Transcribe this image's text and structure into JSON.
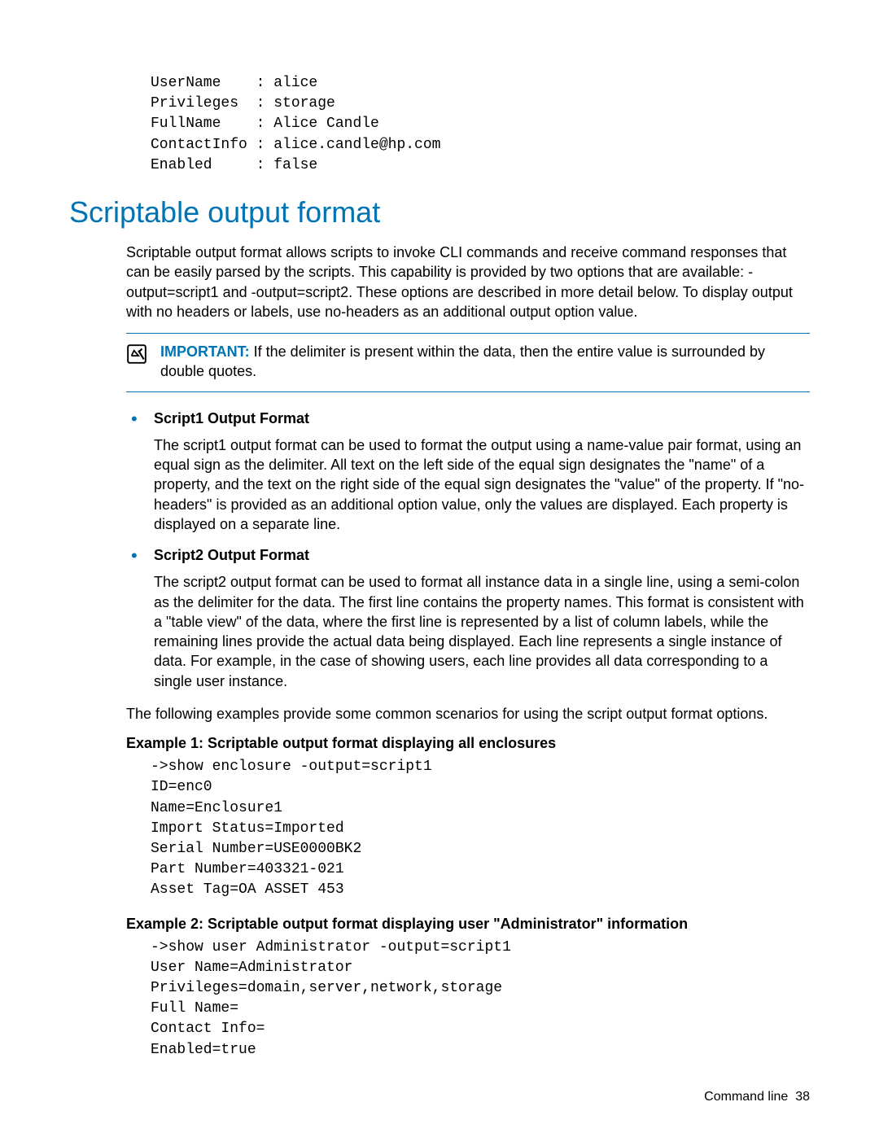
{
  "top_code": "UserName    : alice\nPrivileges  : storage\nFullName    : Alice Candle\nContactInfo : alice.candle@hp.com\nEnabled     : false",
  "section_title": "Scriptable output format",
  "intro_para": "Scriptable output format allows scripts to invoke CLI commands and receive command responses that can be easily parsed by the scripts. This capability is provided by two options that are available: -output=script1 and -output=script2. These options are described in more detail below. To display output with no headers or labels, use no-headers as an additional output option value.",
  "important": {
    "label": "IMPORTANT:",
    "text": "  If the delimiter is present within the data, then the entire value is surrounded by double quotes."
  },
  "bullets": [
    {
      "title": "Script1 Output Format",
      "body": "The script1 output format can be used to format the output using a name-value pair format, using an equal sign as the delimiter. All text on the left side of the equal sign designates the \"name\" of a property, and the text on the right side of the equal sign designates the \"value\" of the property. If \"no-headers\" is provided as an additional option value, only the values are displayed. Each property is displayed on a separate line."
    },
    {
      "title": "Script2 Output Format",
      "body": "The script2 output format can be used to format all instance data in a single line, using a semi-colon as the delimiter for the data. The first line contains the property names. This format is consistent with a \"table view\" of the data, where the first line is represented by a list of column labels, while the remaining lines provide the actual data being displayed. Each line represents a single instance of data. For example, in the case of showing users, each line provides all data corresponding to a single user instance."
    }
  ],
  "examples_intro": "The following examples provide some common scenarios for using the script output format options.",
  "examples": [
    {
      "title": "Example 1: Scriptable output format displaying all enclosures",
      "code": "->show enclosure -output=script1\nID=enc0\nName=Enclosure1\nImport Status=Imported\nSerial Number=USE0000BK2\nPart Number=403321-021\nAsset Tag=OA ASSET 453"
    },
    {
      "title": "Example 2: Scriptable output format displaying user \"Administrator\" information",
      "code": "->show user Administrator -output=script1\nUser Name=Administrator\nPrivileges=domain,server,network,storage\nFull Name=\nContact Info=\nEnabled=true"
    }
  ],
  "footer": {
    "section": "Command line",
    "page": "38"
  }
}
